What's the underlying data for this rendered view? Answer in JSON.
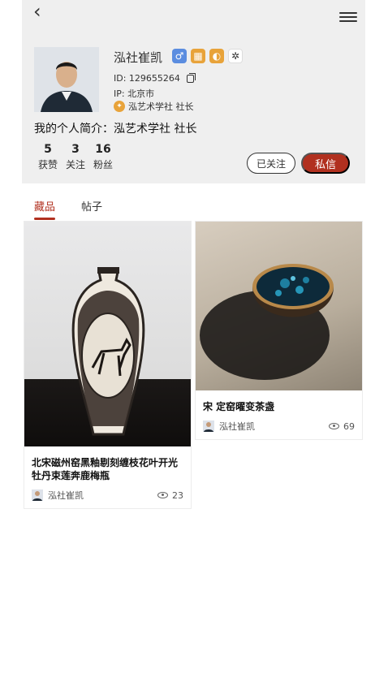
{
  "nav": {
    "back_icon": "chevron-left-icon",
    "back_glyph": "‹",
    "menu_icon": "menu-icon"
  },
  "profile": {
    "name": "泓社崔凯",
    "badges": [
      {
        "icon": "male-icon",
        "glyph": "♂"
      },
      {
        "icon": "level-badge-icon",
        "glyph": "▦"
      },
      {
        "icon": "coin-badge-icon",
        "glyph": "◐"
      },
      {
        "icon": "flower-badge-icon",
        "glyph": "✲"
      }
    ],
    "id_text": "ID: 129655264",
    "ip_text": "IP: 北京市",
    "org_text": "泓艺术学社 社长",
    "bio": "我的个人简介：泓艺术学社 社长",
    "stats": [
      {
        "value": "5",
        "label": "获赞"
      },
      {
        "value": "3",
        "label": "关注"
      },
      {
        "value": "16",
        "label": "粉丝"
      }
    ],
    "follow_label": "已关注",
    "message_label": "私信"
  },
  "tabs": [
    {
      "label": "藏品",
      "active": true
    },
    {
      "label": "帖子",
      "active": false
    }
  ],
  "items": [
    {
      "title": "北宋磁州窑黑釉剔刻缠枝花叶开光牡丹束莲奔鹿梅瓶",
      "author": "泓社崔凯",
      "views": "23"
    },
    {
      "title": "宋 定窑曜变茶盏",
      "author": "泓社崔凯",
      "views": "69"
    }
  ],
  "colors": {
    "accent": "#b1301f",
    "header_bg": "#efefef"
  }
}
